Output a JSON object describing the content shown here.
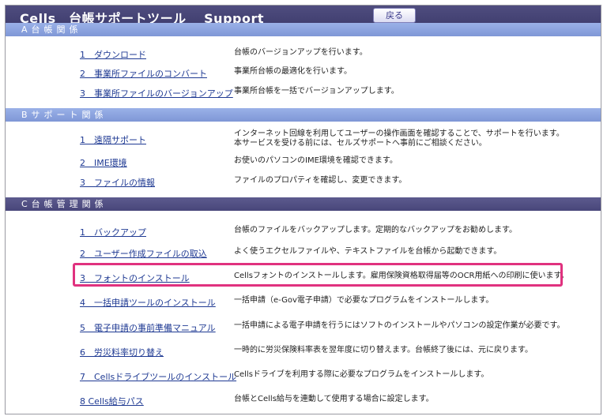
{
  "header": {
    "title": "Cells　台帳サポートツール　 Support",
    "back_label": "戻る"
  },
  "sections": [
    {
      "title": "A台帳関係",
      "items": [
        {
          "link": "1　ダウンロード",
          "desc": "台帳のバージョンアップを行います。"
        },
        {
          "link": "2　事業所ファイルのコンバート",
          "desc": "事業所台帳の最適化を行います。"
        },
        {
          "link": "3　事業所ファイルのバージョンアップ",
          "desc": "事業所台帳を一括でバージョンアップします。"
        }
      ]
    },
    {
      "title": "Bサポート関係",
      "items": [
        {
          "link": "1　遠隔サポート",
          "desc": "インターネット回線を利用してユーザーの操作画面を確認することで、サポートを行います。",
          "desc2": "本サービスを受ける前には、セルズサポートへ事前にご相談ください。"
        },
        {
          "link": "2　IME環境",
          "desc": "お使いのパソコンのIME環境を確認できます。"
        },
        {
          "link": "3　ファイルの情報",
          "desc": "ファイルのプロパティを確認し、変更できます。"
        }
      ]
    },
    {
      "title": "C台帳管理関係",
      "items": [
        {
          "link": "1　バックアップ",
          "desc": "台帳のファイルをバックアップします。定期的なバックアップをお勧めします。"
        },
        {
          "link": "2　ユーザー作成ファイルの取込",
          "desc": "よく使うエクセルファイルや、テキストファイルを台帳から起動できます。"
        },
        {
          "link": "3　フォントのインストール",
          "desc": "Cellsフォントのインストールします。雇用保険資格取得届等のOCR用紙への印刷に使います。"
        },
        {
          "link": "4　一括申請ツールのインストール",
          "desc": "一括申請（e-Gov電子申請）で必要なプログラムをインストールします。"
        },
        {
          "link": "5　電子申請の事前準備マニュアル",
          "desc": "一括申請による電子申請を行うにはソフトのインストールやパソコンの設定作業が必要です。"
        },
        {
          "link": "6　労災料率切り替え",
          "desc": "一時的に労災保険料率表を翌年度に切り替えます。台帳終了後には、元に戻ります。"
        },
        {
          "link": "7　Cellsドライブツールのインストール",
          "desc": "Cellsドライブを利用する際に必要なプログラムをインストールします。"
        },
        {
          "link": "8 Cells給与パス",
          "desc": "台帳とCells給与を連動して使用する場合に設定します。"
        }
      ]
    }
  ],
  "colors": {
    "title_bar": "#45437a",
    "section_a": "#8aa2de",
    "section_b": "#8aa2de",
    "section_c": "#504e82",
    "highlight": "#e0327f",
    "link": "#1f3a93"
  }
}
